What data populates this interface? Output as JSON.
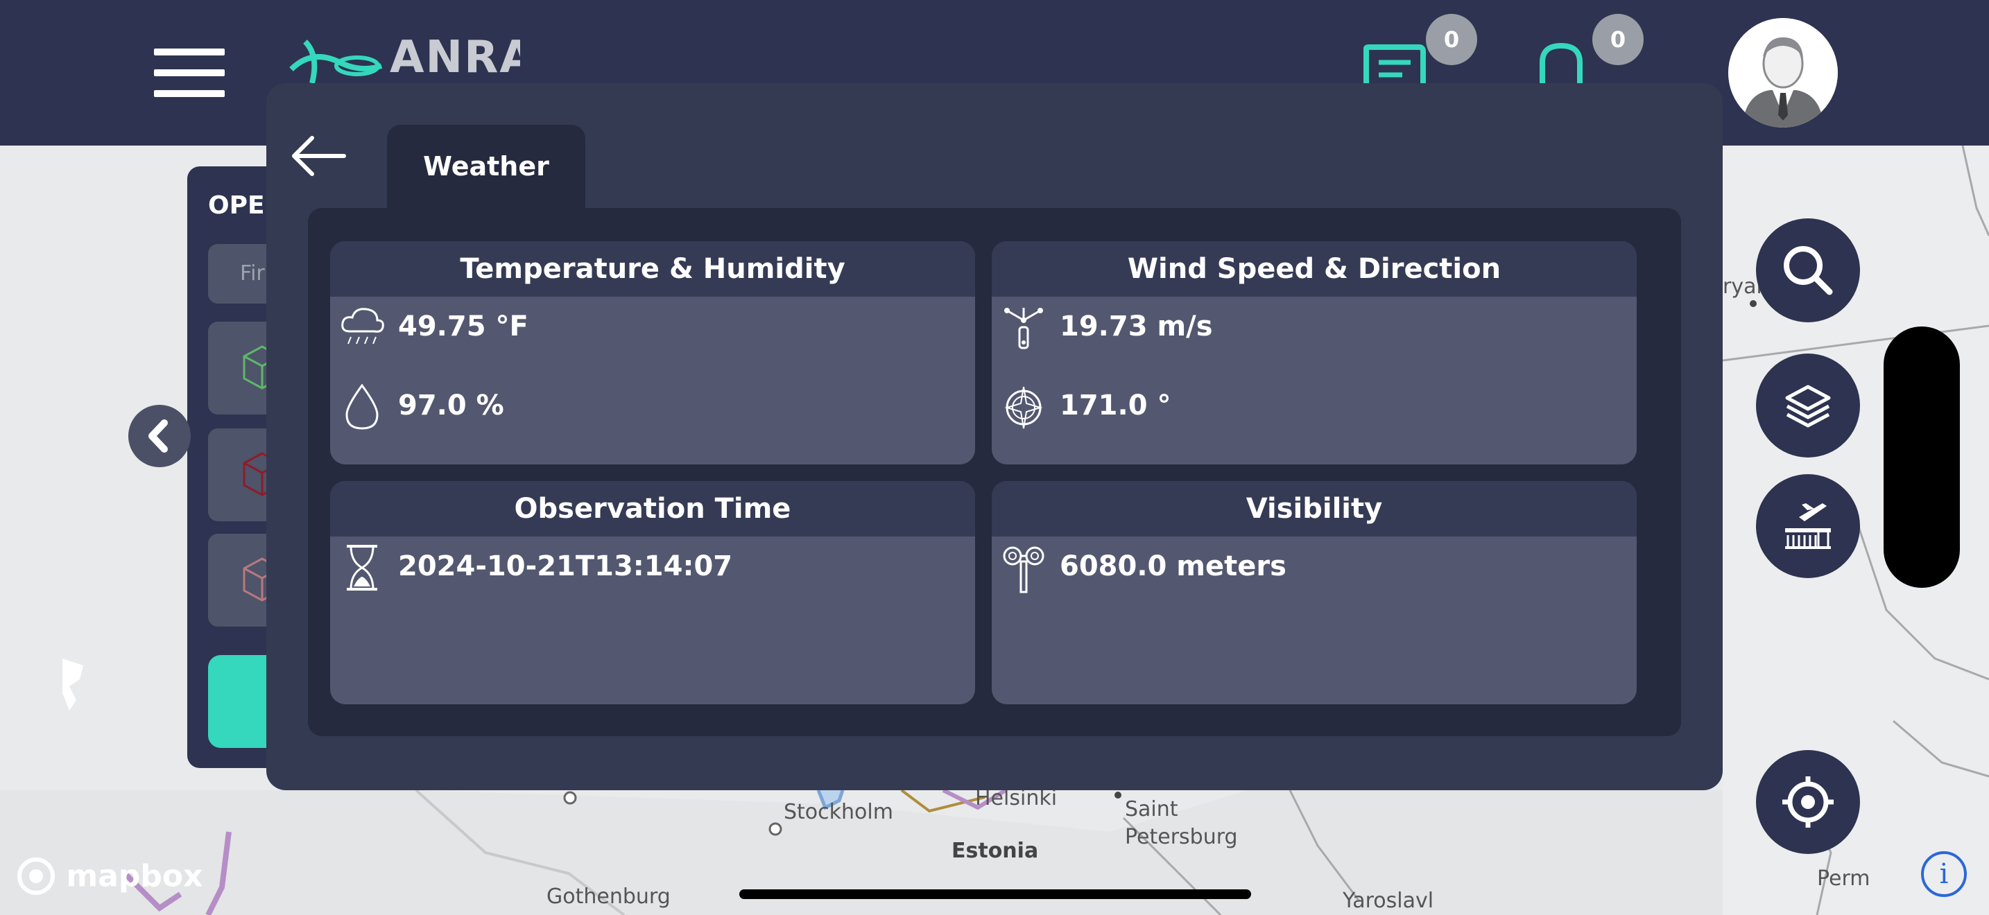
{
  "header": {
    "logo_text": "ANRA NOON",
    "tasks_badge": "0",
    "alerts_badge": "0"
  },
  "sidepanel": {
    "title": "OPEI",
    "search_placeholder": "Fir"
  },
  "map": {
    "labels": [
      "Stockholm",
      "Helsinki",
      "Saint",
      "Petersburg",
      "Estonia",
      "Gothenburg",
      "Yaroslavl",
      "Perm",
      "ryar"
    ],
    "attribution": "mapbox"
  },
  "modal": {
    "tab_label": "Weather",
    "cards": [
      {
        "title": "Temperature & Humidity",
        "rows": [
          {
            "icon": "cloud-rain-icon",
            "value": "49.75 °F"
          },
          {
            "icon": "water-drop-icon",
            "value": "97.0 %"
          }
        ]
      },
      {
        "title": "Wind Speed & Direction",
        "rows": [
          {
            "icon": "anemometer-icon",
            "value": "19.73 m/s"
          },
          {
            "icon": "compass-icon",
            "value": "171.0 °"
          }
        ]
      },
      {
        "title": "Observation Time",
        "rows": [
          {
            "icon": "hourglass-icon",
            "value": "2024-10-21T13:14:07"
          }
        ]
      },
      {
        "title": "Visibility",
        "rows": [
          {
            "icon": "binoculars-icon",
            "value": "6080.0 meters"
          }
        ]
      }
    ]
  },
  "colors": {
    "navy": "#2d3350",
    "teal": "#35d7bd",
    "card": "#535870"
  }
}
